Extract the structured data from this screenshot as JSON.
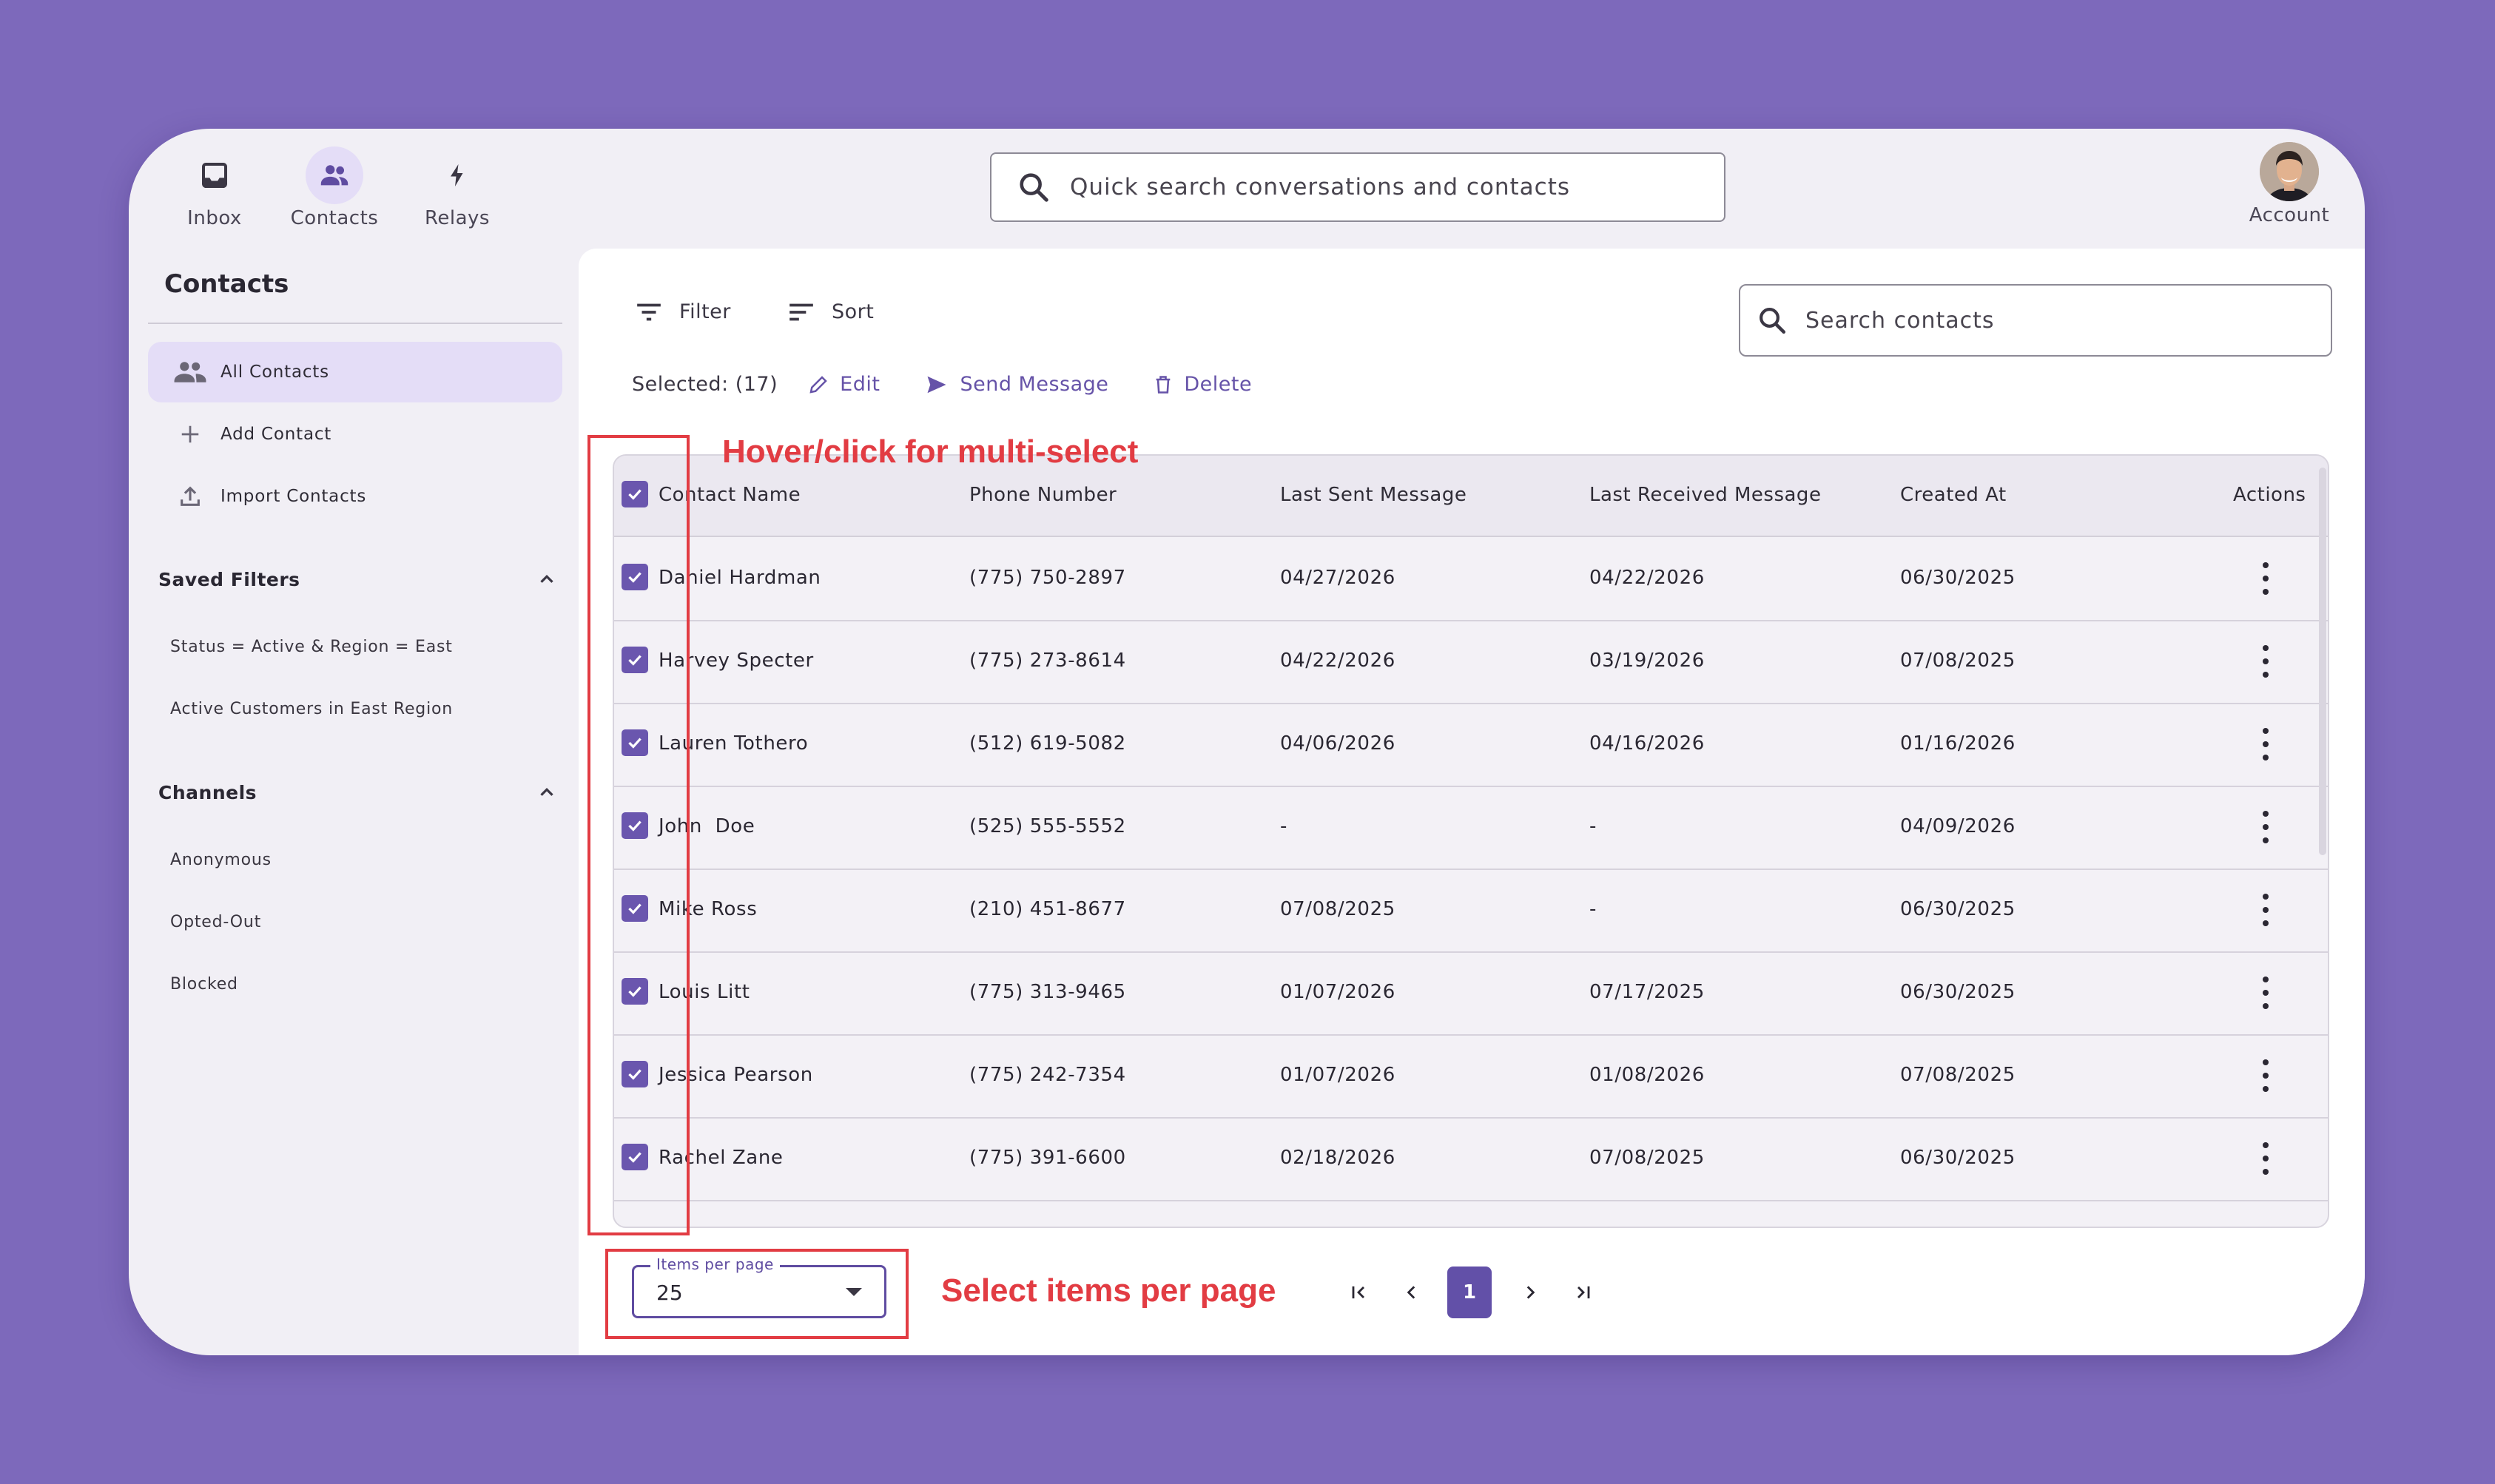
{
  "nav": {
    "items": [
      {
        "label": "Inbox",
        "icon": "inbox-icon"
      },
      {
        "label": "Contacts",
        "icon": "contacts-icon"
      },
      {
        "label": "Relays",
        "icon": "bolt-icon"
      }
    ],
    "search_placeholder": "Quick search conversations and contacts",
    "account_label": "Account"
  },
  "sidebar": {
    "title": "Contacts",
    "items": [
      {
        "label": "All Contacts",
        "icon": "people-icon"
      },
      {
        "label": "Add Contact",
        "icon": "plus-icon"
      },
      {
        "label": "Import Contacts",
        "icon": "upload-icon"
      }
    ],
    "saved_filters": {
      "title": "Saved Filters",
      "items": [
        "Status = Active & Region = East",
        "Active Customers in East Region"
      ]
    },
    "channels": {
      "title": "Channels",
      "items": [
        "Anonymous",
        "Opted-Out",
        "Blocked"
      ]
    }
  },
  "toolbar": {
    "filter_label": "Filter",
    "sort_label": "Sort",
    "search_placeholder": "Search contacts",
    "selected_text": "Selected: (17)",
    "edit_label": "Edit",
    "send_label": "Send Message",
    "delete_label": "Delete"
  },
  "table": {
    "columns": [
      "Contact Name",
      "Phone Number",
      "Last Sent Message",
      "Last Received Message",
      "Created At",
      "Actions"
    ],
    "rows": [
      {
        "name": "Daniel Hardman",
        "phone": "(775) 750-2897",
        "sent": "04/27/2026",
        "received": "04/22/2026",
        "created": "06/30/2025"
      },
      {
        "name": "Harvey Specter",
        "phone": "(775) 273-8614",
        "sent": "04/22/2026",
        "received": "03/19/2026",
        "created": "07/08/2025"
      },
      {
        "name": "Lauren Tothero",
        "phone": "(512) 619-5082",
        "sent": "04/06/2026",
        "received": "04/16/2026",
        "created": "01/16/2026"
      },
      {
        "name": "John  Doe",
        "phone": "(525) 555-5552",
        "sent": "-",
        "received": "-",
        "created": "04/09/2026"
      },
      {
        "name": "Mike Ross",
        "phone": "(210) 451-8677",
        "sent": "07/08/2025",
        "received": "-",
        "created": "06/30/2025"
      },
      {
        "name": "Louis Litt",
        "phone": "(775) 313-9465",
        "sent": "01/07/2026",
        "received": "07/17/2025",
        "created": "06/30/2025"
      },
      {
        "name": "Jessica Pearson",
        "phone": "(775) 242-7354",
        "sent": "01/07/2026",
        "received": "01/08/2026",
        "created": "07/08/2025"
      },
      {
        "name": "Rachel Zane",
        "phone": "(775) 391-6600",
        "sent": "02/18/2026",
        "received": "07/08/2025",
        "created": "06/30/2025"
      }
    ]
  },
  "pagination": {
    "items_per_page_label": "Items per page",
    "items_per_page_value": "25",
    "current_page": "1"
  },
  "annotations": {
    "multi_select": "Hover/click for multi-select",
    "items_per_page": "Select items per page"
  },
  "colors": {
    "background": "#7d69bb",
    "accent": "#6a56ae",
    "annotation": "#e23c43"
  }
}
